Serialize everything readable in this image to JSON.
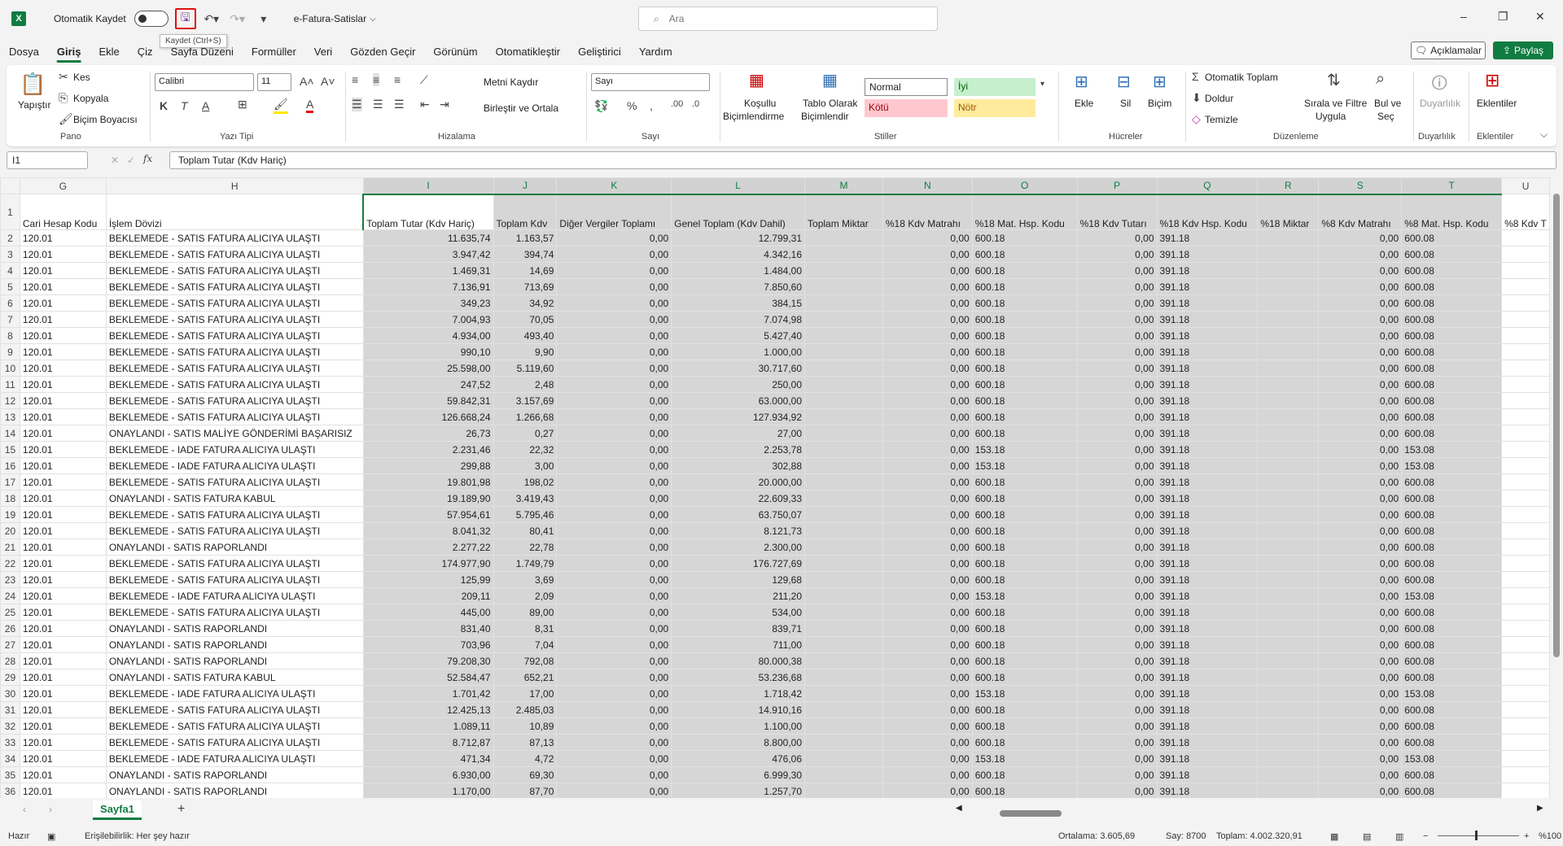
{
  "window": {
    "autosave_label": "Otomatik Kaydet",
    "doc_title": "e-Fatura-Satislar",
    "search_placeholder": "Ara",
    "save_tooltip": "Kaydet (Ctrl+S)"
  },
  "menu": [
    "Dosya",
    "Giriş",
    "Ekle",
    "Çiz",
    "Sayfa Düzeni",
    "Formüller",
    "Veri",
    "Gözden Geçir",
    "Görünüm",
    "Otomatikleştir",
    "Geliştirici",
    "Yardım"
  ],
  "header_buttons": {
    "comments": "Açıklamalar",
    "share": "Paylaş"
  },
  "ribbon": {
    "paste": "Yapıştır",
    "cut": "Kes",
    "copy": "Kopyala",
    "format_painter": "Biçim Boyacısı",
    "group_clipboard": "Pano",
    "font_name": "Calibri",
    "font_size": "11",
    "group_font": "Yazı Tipi",
    "wrap_text": "Metni Kaydır",
    "merge_center": "Birleştir ve Ortala",
    "group_alignment": "Hizalama",
    "number_format": "Sayı",
    "group_number": "Sayı",
    "cond_format_1": "Koşullu",
    "cond_format_2": "Biçimlendirme",
    "table_format_1": "Tablo Olarak",
    "table_format_2": "Biçimlendir",
    "style_normal": "Normal",
    "style_good": "İyi",
    "style_bad": "Kötü",
    "style_neutral": "Nötr",
    "group_styles": "Stiller",
    "insert": "Ekle",
    "delete": "Sil",
    "format": "Biçim",
    "group_cells": "Hücreler",
    "autosum": "Otomatik Toplam",
    "fill": "Doldur",
    "clear": "Temizle",
    "sort_filter_1": "Sırala ve Filtre",
    "sort_filter_2": "Uygula",
    "find_select_1": "Bul ve",
    "find_select_2": "Seç",
    "group_editing": "Düzenleme",
    "sensitivity": "Duyarlılık",
    "group_sensitivity": "Duyarlılık",
    "addins": "Eklentiler",
    "group_addins": "Eklentiler"
  },
  "formula_bar": {
    "name_box": "I1",
    "formula": "Toplam Tutar (Kdv Hariç)"
  },
  "columns": [
    "G",
    "H",
    "I",
    "J",
    "K",
    "L",
    "M",
    "N",
    "O",
    "P",
    "Q",
    "R",
    "S",
    "T",
    "U"
  ],
  "header_row": [
    "Cari Hesap Kodu",
    "İşlem Dövizi",
    "Toplam Tutar (Kdv Hariç)",
    "Toplam Kdv",
    "Diğer Vergiler Toplamı",
    "Genel Toplam  (Kdv Dahil)",
    "Toplam Miktar",
    "%18 Kdv Matrahı",
    "%18 Mat. Hsp. Kodu",
    "%18 Kdv Tutarı",
    "%18 Kdv Hsp. Kodu",
    "%18 Miktar",
    "%8 Kdv Matrahı",
    "%8 Mat. Hsp. Kodu",
    "%8 Kdv T"
  ],
  "rows": [
    [
      "120.01",
      "BEKLEMEDE - SATIS FATURA ALICIYA ULAŞTI",
      "11.635,74",
      "1.163,57",
      "0,00",
      "12.799,31",
      "",
      "0,00",
      "600.18",
      "0,00",
      "391.18",
      "",
      "0,00",
      "600.08",
      ""
    ],
    [
      "120.01",
      "BEKLEMEDE - SATIS FATURA ALICIYA ULAŞTI",
      "3.947,42",
      "394,74",
      "0,00",
      "4.342,16",
      "",
      "0,00",
      "600.18",
      "0,00",
      "391.18",
      "",
      "0,00",
      "600.08",
      ""
    ],
    [
      "120.01",
      "BEKLEMEDE - SATIS FATURA ALICIYA ULAŞTI",
      "1.469,31",
      "14,69",
      "0,00",
      "1.484,00",
      "",
      "0,00",
      "600.18",
      "0,00",
      "391.18",
      "",
      "0,00",
      "600.08",
      ""
    ],
    [
      "120.01",
      "BEKLEMEDE - SATIS FATURA ALICIYA ULAŞTI",
      "7.136,91",
      "713,69",
      "0,00",
      "7.850,60",
      "",
      "0,00",
      "600.18",
      "0,00",
      "391.18",
      "",
      "0,00",
      "600.08",
      ""
    ],
    [
      "120.01",
      "BEKLEMEDE - SATIS FATURA ALICIYA ULAŞTI",
      "349,23",
      "34,92",
      "0,00",
      "384,15",
      "",
      "0,00",
      "600.18",
      "0,00",
      "391.18",
      "",
      "0,00",
      "600.08",
      ""
    ],
    [
      "120.01",
      "BEKLEMEDE - SATIS FATURA ALICIYA ULAŞTI",
      "7.004,93",
      "70,05",
      "0,00",
      "7.074,98",
      "",
      "0,00",
      "600.18",
      "0,00",
      "391.18",
      "",
      "0,00",
      "600.08",
      ""
    ],
    [
      "120.01",
      "BEKLEMEDE - SATIS FATURA ALICIYA ULAŞTI",
      "4.934,00",
      "493,40",
      "0,00",
      "5.427,40",
      "",
      "0,00",
      "600.18",
      "0,00",
      "391.18",
      "",
      "0,00",
      "600.08",
      ""
    ],
    [
      "120.01",
      "BEKLEMEDE - SATIS FATURA ALICIYA ULAŞTI",
      "990,10",
      "9,90",
      "0,00",
      "1.000,00",
      "",
      "0,00",
      "600.18",
      "0,00",
      "391.18",
      "",
      "0,00",
      "600.08",
      ""
    ],
    [
      "120.01",
      "BEKLEMEDE - SATIS FATURA ALICIYA ULAŞTI",
      "25.598,00",
      "5.119,60",
      "0,00",
      "30.717,60",
      "",
      "0,00",
      "600.18",
      "0,00",
      "391.18",
      "",
      "0,00",
      "600.08",
      ""
    ],
    [
      "120.01",
      "BEKLEMEDE - SATIS FATURA ALICIYA ULAŞTI",
      "247,52",
      "2,48",
      "0,00",
      "250,00",
      "",
      "0,00",
      "600.18",
      "0,00",
      "391.18",
      "",
      "0,00",
      "600.08",
      ""
    ],
    [
      "120.01",
      "BEKLEMEDE - SATIS FATURA ALICIYA ULAŞTI",
      "59.842,31",
      "3.157,69",
      "0,00",
      "63.000,00",
      "",
      "0,00",
      "600.18",
      "0,00",
      "391.18",
      "",
      "0,00",
      "600.08",
      ""
    ],
    [
      "120.01",
      "BEKLEMEDE - SATIS FATURA ALICIYA ULAŞTI",
      "126.668,24",
      "1.266,68",
      "0,00",
      "127.934,92",
      "",
      "0,00",
      "600.18",
      "0,00",
      "391.18",
      "",
      "0,00",
      "600.08",
      ""
    ],
    [
      "120.01",
      "ONAYLANDI - SATIS MALİYE GÖNDERİMİ BAŞARISIZ",
      "26,73",
      "0,27",
      "0,00",
      "27,00",
      "",
      "0,00",
      "600.18",
      "0,00",
      "391.18",
      "",
      "0,00",
      "600.08",
      ""
    ],
    [
      "120.01",
      "BEKLEMEDE - IADE FATURA ALICIYA ULAŞTI",
      "2.231,46",
      "22,32",
      "0,00",
      "2.253,78",
      "",
      "0,00",
      "153.18",
      "0,00",
      "391.18",
      "",
      "0,00",
      "153.08",
      ""
    ],
    [
      "120.01",
      "BEKLEMEDE - IADE FATURA ALICIYA ULAŞTI",
      "299,88",
      "3,00",
      "0,00",
      "302,88",
      "",
      "0,00",
      "153.18",
      "0,00",
      "391.18",
      "",
      "0,00",
      "153.08",
      ""
    ],
    [
      "120.01",
      "BEKLEMEDE - SATIS FATURA ALICIYA ULAŞTI",
      "19.801,98",
      "198,02",
      "0,00",
      "20.000,00",
      "",
      "0,00",
      "600.18",
      "0,00",
      "391.18",
      "",
      "0,00",
      "600.08",
      ""
    ],
    [
      "120.01",
      "ONAYLANDI - SATIS FATURA KABUL",
      "19.189,90",
      "3.419,43",
      "0,00",
      "22.609,33",
      "",
      "0,00",
      "600.18",
      "0,00",
      "391.18",
      "",
      "0,00",
      "600.08",
      ""
    ],
    [
      "120.01",
      "BEKLEMEDE - SATIS FATURA ALICIYA ULAŞTI",
      "57.954,61",
      "5.795,46",
      "0,00",
      "63.750,07",
      "",
      "0,00",
      "600.18",
      "0,00",
      "391.18",
      "",
      "0,00",
      "600.08",
      ""
    ],
    [
      "120.01",
      "BEKLEMEDE - SATIS FATURA ALICIYA ULAŞTI",
      "8.041,32",
      "80,41",
      "0,00",
      "8.121,73",
      "",
      "0,00",
      "600.18",
      "0,00",
      "391.18",
      "",
      "0,00",
      "600.08",
      ""
    ],
    [
      "120.01",
      "ONAYLANDI - SATIS RAPORLANDI",
      "2.277,22",
      "22,78",
      "0,00",
      "2.300,00",
      "",
      "0,00",
      "600.18",
      "0,00",
      "391.18",
      "",
      "0,00",
      "600.08",
      ""
    ],
    [
      "120.01",
      "BEKLEMEDE - SATIS FATURA ALICIYA ULAŞTI",
      "174.977,90",
      "1.749,79",
      "0,00",
      "176.727,69",
      "",
      "0,00",
      "600.18",
      "0,00",
      "391.18",
      "",
      "0,00",
      "600.08",
      ""
    ],
    [
      "120.01",
      "BEKLEMEDE - SATIS FATURA ALICIYA ULAŞTI",
      "125,99",
      "3,69",
      "0,00",
      "129,68",
      "",
      "0,00",
      "600.18",
      "0,00",
      "391.18",
      "",
      "0,00",
      "600.08",
      ""
    ],
    [
      "120.01",
      "BEKLEMEDE - IADE FATURA ALICIYA ULAŞTI",
      "209,11",
      "2,09",
      "0,00",
      "211,20",
      "",
      "0,00",
      "153.18",
      "0,00",
      "391.18",
      "",
      "0,00",
      "153.08",
      ""
    ],
    [
      "120.01",
      "BEKLEMEDE - SATIS FATURA ALICIYA ULAŞTI",
      "445,00",
      "89,00",
      "0,00",
      "534,00",
      "",
      "0,00",
      "600.18",
      "0,00",
      "391.18",
      "",
      "0,00",
      "600.08",
      ""
    ],
    [
      "120.01",
      "ONAYLANDI - SATIS RAPORLANDI",
      "831,40",
      "8,31",
      "0,00",
      "839,71",
      "",
      "0,00",
      "600.18",
      "0,00",
      "391.18",
      "",
      "0,00",
      "600.08",
      ""
    ],
    [
      "120.01",
      "ONAYLANDI - SATIS RAPORLANDI",
      "703,96",
      "7,04",
      "0,00",
      "711,00",
      "",
      "0,00",
      "600.18",
      "0,00",
      "391.18",
      "",
      "0,00",
      "600.08",
      ""
    ],
    [
      "120.01",
      "ONAYLANDI - SATIS RAPORLANDI",
      "79.208,30",
      "792,08",
      "0,00",
      "80.000,38",
      "",
      "0,00",
      "600.18",
      "0,00",
      "391.18",
      "",
      "0,00",
      "600.08",
      ""
    ],
    [
      "120.01",
      "ONAYLANDI - SATIS FATURA KABUL",
      "52.584,47",
      "652,21",
      "0,00",
      "53.236,68",
      "",
      "0,00",
      "600.18",
      "0,00",
      "391.18",
      "",
      "0,00",
      "600.08",
      ""
    ],
    [
      "120.01",
      "BEKLEMEDE - IADE FATURA ALICIYA ULAŞTI",
      "1.701,42",
      "17,00",
      "0,00",
      "1.718,42",
      "",
      "0,00",
      "153.18",
      "0,00",
      "391.18",
      "",
      "0,00",
      "153.08",
      ""
    ],
    [
      "120.01",
      "BEKLEMEDE - SATIS FATURA ALICIYA ULAŞTI",
      "12.425,13",
      "2.485,03",
      "0,00",
      "14.910,16",
      "",
      "0,00",
      "600.18",
      "0,00",
      "391.18",
      "",
      "0,00",
      "600.08",
      ""
    ],
    [
      "120.01",
      "BEKLEMEDE - SATIS FATURA ALICIYA ULAŞTI",
      "1.089,11",
      "10,89",
      "0,00",
      "1.100,00",
      "",
      "0,00",
      "600.18",
      "0,00",
      "391.18",
      "",
      "0,00",
      "600.08",
      ""
    ],
    [
      "120.01",
      "BEKLEMEDE - SATIS FATURA ALICIYA ULAŞTI",
      "8.712,87",
      "87,13",
      "0,00",
      "8.800,00",
      "",
      "0,00",
      "600.18",
      "0,00",
      "391.18",
      "",
      "0,00",
      "600.08",
      ""
    ],
    [
      "120.01",
      "BEKLEMEDE - IADE FATURA ALICIYA ULAŞTI",
      "471,34",
      "4,72",
      "0,00",
      "476,06",
      "",
      "0,00",
      "153.18",
      "0,00",
      "391.18",
      "",
      "0,00",
      "153.08",
      ""
    ],
    [
      "120.01",
      "ONAYLANDI - SATIS RAPORLANDI",
      "6.930,00",
      "69,30",
      "0,00",
      "6.999,30",
      "",
      "0,00",
      "600.18",
      "0,00",
      "391.18",
      "",
      "0,00",
      "600.08",
      ""
    ],
    [
      "120.01",
      "ONAYLANDI - SATIS RAPORLANDI",
      "1.170,00",
      "87,70",
      "0,00",
      "1.257,70",
      "",
      "0,00",
      "600.18",
      "0,00",
      "391.18",
      "",
      "0,00",
      "600.08",
      ""
    ]
  ],
  "sheet_tab": "Sayfa1",
  "status": {
    "ready": "Hazır",
    "accessibility": "Erişilebilirlik: Her şey hazır",
    "average": "Ortalama: 3.605,69",
    "count": "Say: 8700",
    "sum": "Toplam: 4.002.320,91",
    "zoom": "%100"
  }
}
